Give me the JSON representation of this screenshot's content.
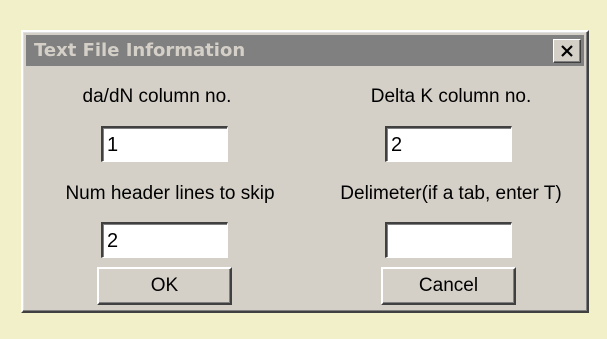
{
  "window": {
    "title": "Text File Information",
    "close_label": "×"
  },
  "fields": {
    "dadn_label": "da/dN column no.",
    "dadn_value": "1",
    "deltak_label": "Delta K column no.",
    "deltak_value": "2",
    "header_label": "Num header lines to skip",
    "header_value": "2",
    "delim_label": "Delimeter(if a tab, enter T)",
    "delim_value": ""
  },
  "buttons": {
    "ok_label": "OK",
    "cancel_label": "Cancel"
  },
  "colors": {
    "page_bg": "#f1f0c8",
    "dialog_face": "#d4d0c8",
    "inactive_title": "#808080"
  }
}
